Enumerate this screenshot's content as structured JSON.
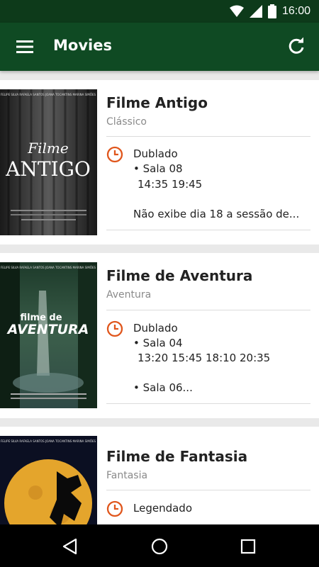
{
  "status": {
    "time": "16:00"
  },
  "appbar": {
    "title": "Movies"
  },
  "movies": [
    {
      "title": "Filme Antigo",
      "genre": "Clássico",
      "poster": {
        "credits": "FELIPE SILVA   RAFAELA SANTOS   JOANA TOCANTINS   MARINA SIMÕES",
        "line1": "Filme",
        "line2": "ANTIGO"
      },
      "audio": "Dublado",
      "room": "• Sala 08",
      "times": "14:35 19:45",
      "note": "Não exibe dia 18 a sessão de..."
    },
    {
      "title": "Filme de Aventura",
      "genre": "Aventura",
      "poster": {
        "credits": "FELIPE SILVA   RAFAELA SANTOS   JOANA TOCANTINS   MARINA SIMÕES",
        "line1": "filme de",
        "line2": "AVENTURA"
      },
      "audio": "Dublado",
      "room": "• Sala 04",
      "times": "13:20 15:45 18:10 20:35",
      "note": "• Sala 06..."
    },
    {
      "title": "Filme de Fantasia",
      "genre": "Fantasia",
      "poster": {
        "credits": "FELIPE SILVA   RAFAELA SANTOS   JOANA TOCANTINS   MARINA SIMÕES",
        "line1": "",
        "line2": ""
      },
      "audio": "Legendado"
    }
  ],
  "colors": {
    "appbar": "#0f4a23",
    "statusbar": "#0d3a1a",
    "clock": "#e0561c"
  }
}
